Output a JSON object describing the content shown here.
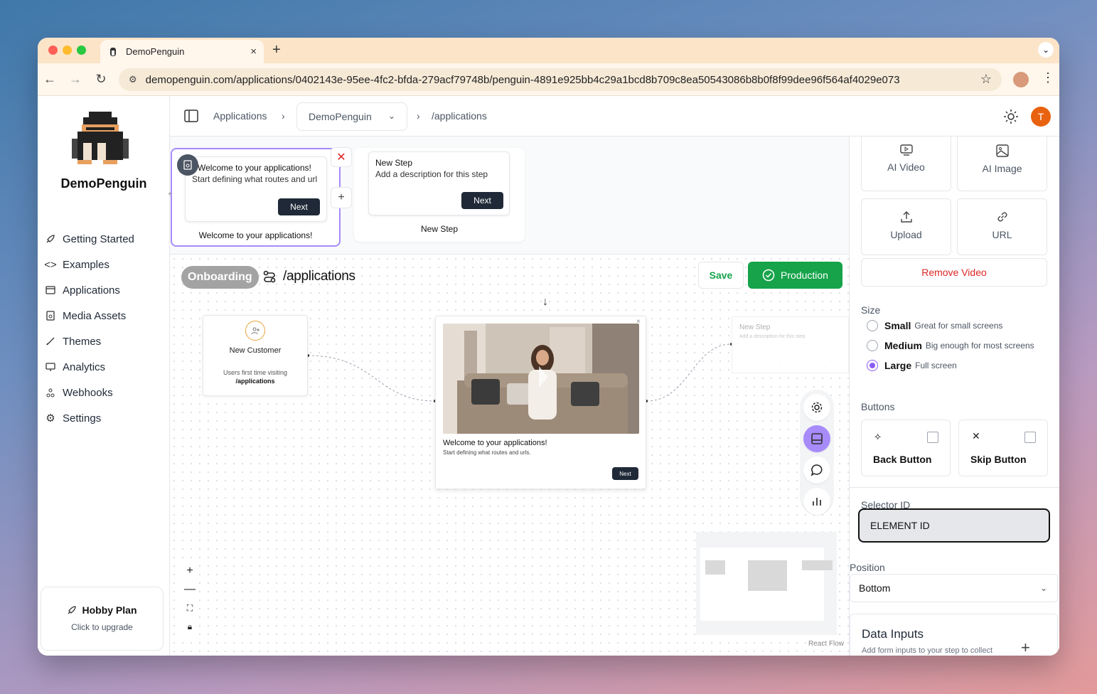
{
  "browser": {
    "tab_title": "DemoPenguin",
    "tab_close": "×",
    "new_tab": "+",
    "url": "demopenguin.com/applications/0402143e-95ee-4fc2-bfda-279acf79748b/penguin-4891e925bb4c29a1bcd8b709c8ea50543086b8b0f8f99dee96f564af4029e073"
  },
  "sidebar": {
    "brand": "DemoPenguin",
    "items": [
      {
        "label": "Getting Started",
        "icon": "rocket-icon"
      },
      {
        "label": "Examples",
        "icon": "code-icon"
      },
      {
        "label": "Applications",
        "icon": "window-icon"
      },
      {
        "label": "Media Assets",
        "icon": "media-icon"
      },
      {
        "label": "Themes",
        "icon": "brush-icon"
      },
      {
        "label": "Analytics",
        "icon": "monitor-icon"
      },
      {
        "label": "Webhooks",
        "icon": "webhook-icon"
      },
      {
        "label": "Settings",
        "icon": "gear-icon"
      }
    ],
    "plan": {
      "title": "Hobby Plan",
      "subtitle": "Click to upgrade"
    }
  },
  "header": {
    "breadcrumb_root": "Applications",
    "app_select": "DemoPenguin",
    "path": "/applications",
    "avatar_initial": "T"
  },
  "steps": [
    {
      "title": "Welcome to your applications!",
      "description": "Start defining what routes and url",
      "button": "Next",
      "label": "Welcome to your applications!"
    },
    {
      "title": "New Step",
      "description": "Add a description for this step",
      "button": "Next",
      "label": "New Step"
    }
  ],
  "canvas": {
    "badge": "Onboarding",
    "route": "/applications",
    "save": "Save",
    "production": "Production",
    "customer_node": {
      "title": "New Customer",
      "desc": "Users first time visiting",
      "path": "/applications"
    },
    "main_node": {
      "title": "Welcome to your applications!",
      "desc": "Start defining what routes and urls.",
      "button": "Next"
    },
    "ghost_node": {
      "title": "New Step",
      "desc": "Add a description for this step"
    },
    "attribution": "React Flow"
  },
  "panel": {
    "media": [
      {
        "label": "AI Video",
        "icon": "ai-video-icon"
      },
      {
        "label": "AI Image",
        "icon": "image-icon"
      },
      {
        "label": "Upload",
        "icon": "upload-icon"
      },
      {
        "label": "URL",
        "icon": "link-icon"
      }
    ],
    "remove_video": "Remove Video",
    "size_label": "Size",
    "sizes": [
      {
        "name": "Small",
        "desc": "Great for small screens",
        "selected": false
      },
      {
        "name": "Medium",
        "desc": "Big enough for most screens",
        "selected": false
      },
      {
        "name": "Large",
        "desc": "Full screen",
        "selected": true
      }
    ],
    "buttons_label": "Buttons",
    "back_button": "Back Button",
    "skip_button": "Skip Button",
    "selector_label": "Selector ID",
    "selector_value": "ELEMENT ID",
    "position_label": "Position",
    "position_value": "Bottom",
    "data_inputs_title": "Data Inputs",
    "data_inputs_sub": "Add form inputs to your step to collect"
  },
  "colors": {
    "accent": "#8b5cf6",
    "production": "#16a34a",
    "danger": "#dc2626",
    "avatar": "#e8620f"
  }
}
